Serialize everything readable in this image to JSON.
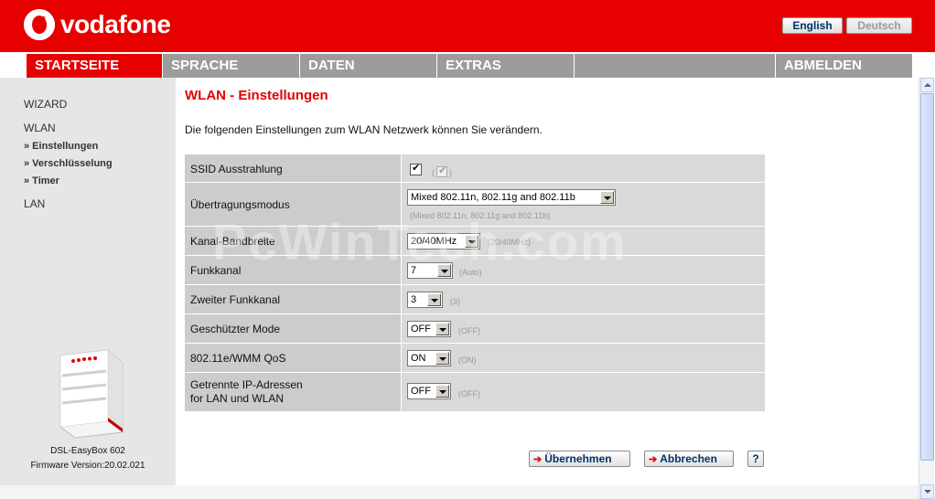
{
  "header": {
    "brand": "vodafone",
    "lang_en": "English",
    "lang_de": "Deutsch",
    "brand_color": "#e60000"
  },
  "nav": {
    "items": [
      "STARTSEITE",
      "SPRACHE",
      "DATEN",
      "EXTRAS",
      "",
      "ABMELDEN"
    ]
  },
  "sidebar": {
    "wizard": "WIZARD",
    "wlan": "WLAN",
    "sub": [
      "» Einstellungen",
      "» Verschlüsselung",
      "» Timer"
    ],
    "lan": "LAN",
    "device_name": "DSL-EasyBox 602",
    "firmware": "Firmware Version:20.02.021"
  },
  "main": {
    "title": "WLAN - Einstellungen",
    "intro": "Die folgenden Einstellungen zum WLAN Netzwerk können Sie verändern.",
    "watermark": "PcWinTech.com",
    "rows": [
      {
        "label": "SSID Ausstrahlung",
        "checked": true,
        "hint": "( )"
      },
      {
        "label": "Übertragungsmodus",
        "value": "Mixed 802.11n, 802.11g and 802.11b",
        "hint": "(Mixed 802.11n, 802.11g and 802.11b)"
      },
      {
        "label": "Kanal-Bandbreite",
        "value": "20/40MHz",
        "hint": "(20/40MHz)"
      },
      {
        "label": "Funkkanal",
        "value": "7",
        "hint": "(Auto)"
      },
      {
        "label": "Zweiter Funkkanal",
        "value": "3",
        "hint": "(3)"
      },
      {
        "label": "Geschützter Mode",
        "value": "OFF",
        "hint": "(OFF)"
      },
      {
        "label": "802.11e/WMM QoS",
        "value": "ON",
        "hint": "(ON)"
      },
      {
        "label_line1": "Getrennte IP-Adressen",
        "label_line2": "for LAN und WLAN",
        "value": "OFF",
        "hint": "(OFF)"
      }
    ],
    "apply": "Übernehmen",
    "cancel": "Abbrechen",
    "help": "?"
  }
}
